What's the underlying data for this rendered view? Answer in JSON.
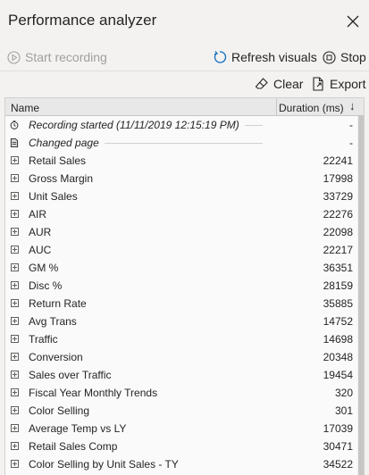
{
  "header": {
    "title": "Performance analyzer"
  },
  "toolbar": {
    "start_recording": "Start recording",
    "refresh_visuals": "Refresh visuals",
    "stop": "Stop",
    "clear": "Clear",
    "export": "Export"
  },
  "table": {
    "col_name": "Name",
    "col_duration": "Duration (ms)",
    "sort_indicator": "↓",
    "rows": [
      {
        "icon": "timer-icon",
        "name": "Recording started (11/11/2019 12:15:19 PM)",
        "duration": "-",
        "italic": true
      },
      {
        "icon": "page-icon",
        "name": "Changed page",
        "duration": "-",
        "italic": true
      },
      {
        "icon": "expand-icon",
        "name": "Retail Sales",
        "duration": "22241"
      },
      {
        "icon": "expand-icon",
        "name": "Gross Margin",
        "duration": "17998"
      },
      {
        "icon": "expand-icon",
        "name": "Unit Sales",
        "duration": "33729"
      },
      {
        "icon": "expand-icon",
        "name": "AIR",
        "duration": "22276"
      },
      {
        "icon": "expand-icon",
        "name": "AUR",
        "duration": "22098"
      },
      {
        "icon": "expand-icon",
        "name": "AUC",
        "duration": "22217"
      },
      {
        "icon": "expand-icon",
        "name": "GM %",
        "duration": "36351"
      },
      {
        "icon": "expand-icon",
        "name": "Disc %",
        "duration": "28159"
      },
      {
        "icon": "expand-icon",
        "name": "Return Rate",
        "duration": "35885"
      },
      {
        "icon": "expand-icon",
        "name": "Avg Trans",
        "duration": "14752"
      },
      {
        "icon": "expand-icon",
        "name": "Traffic",
        "duration": "14698"
      },
      {
        "icon": "expand-icon",
        "name": "Conversion",
        "duration": "20348"
      },
      {
        "icon": "expand-icon",
        "name": "Sales over Traffic",
        "duration": "19454"
      },
      {
        "icon": "expand-icon",
        "name": "Fiscal Year Monthly Trends",
        "duration": "320"
      },
      {
        "icon": "expand-icon",
        "name": "Color Selling",
        "duration": "301"
      },
      {
        "icon": "expand-icon",
        "name": "Average Temp vs LY",
        "duration": "17039"
      },
      {
        "icon": "expand-icon",
        "name": "Retail Sales Comp",
        "duration": "30471"
      },
      {
        "icon": "expand-icon",
        "name": "Color Selling by Unit Sales - TY",
        "duration": "34522"
      }
    ]
  },
  "colors": {
    "background": "#f3f2f1",
    "text": "#252423",
    "disabled": "#a19f9d",
    "table_header": "#e8e8e8"
  }
}
